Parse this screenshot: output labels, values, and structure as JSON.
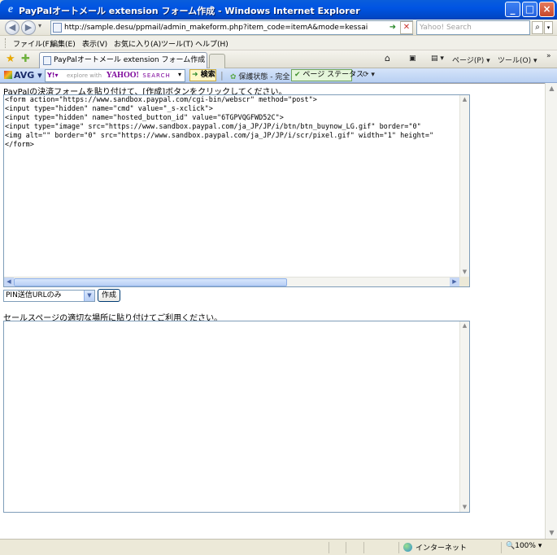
{
  "window": {
    "title": "PayPalオートメール extension  フォーム作成 - Windows Internet Explorer",
    "minimize": "_",
    "maximize": "□",
    "close": "×"
  },
  "address_bar": {
    "url": "http://sample.desu/ppmail/admin_makeform.php?item_code=itemA&mode=kessai",
    "search_placeholder": "Yahoo! Search"
  },
  "menu": [
    "ファイル(F)",
    "編集(E)",
    "表示(V)",
    "お気に入り(A)",
    "ツール(T)",
    "ヘルプ(H)"
  ],
  "tab": {
    "label": "PayPalオートメール extension  フォーム作成"
  },
  "tools": {
    "page": "ページ(P) ▾",
    "tools": "ツール(O) ▾"
  },
  "avg_toolbar": {
    "avg_label": "AVG",
    "explore": "explore with",
    "yahoo": "YAHOO!",
    "yahoo_search": "SEARCH",
    "search_button": "検索",
    "protection": "保護状態 - 完全",
    "page_status": "ページ ステータス"
  },
  "page": {
    "instruction": "PayPalの決済フォームを貼り付けて、[作成]ボタンをクリックしてください。",
    "code": "<form action=\"https://www.sandbox.paypal.com/cgi-bin/webscr\" method=\"post\">\n<input type=\"hidden\" name=\"cmd\" value=\"_s-xclick\">\n<input type=\"hidden\" name=\"hosted_button_id\" value=\"6TGPVQGFWD52C\">\n<input type=\"image\" src=\"https://www.sandbox.paypal.com/ja_JP/JP/i/btn/btn_buynow_LG.gif\" border=\"0\"\n<img alt=\"\" border=\"0\" src=\"https://www.sandbox.paypal.com/ja_JP/JP/i/scr/pixel.gif\" width=\"1\" height=\"\n</form>",
    "select_value": "PIN送信URLのみ",
    "make_button": "作成",
    "paste_label": "セールスページの適切な場所に貼り付けてご利用ください。"
  },
  "status_bar": {
    "zone": "インターネット",
    "zoom": "100%"
  }
}
